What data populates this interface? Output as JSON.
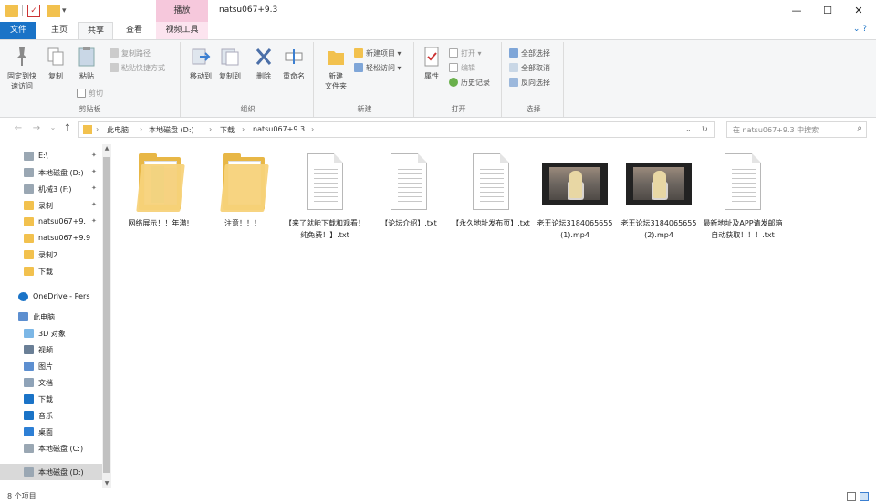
{
  "window": {
    "title": "natsu067+9.3",
    "context_tab_header": "播放",
    "controls": {
      "minimize": "—",
      "maximize": "☐",
      "close": "✕"
    }
  },
  "quick_access": {
    "dropdown": "▾"
  },
  "tabs": {
    "file": "文件",
    "home": "主页",
    "share": "共享",
    "view": "查看",
    "video_tools": "视频工具",
    "help": "⌄ ?"
  },
  "ribbon": {
    "clipboard": {
      "label": "剪贴板",
      "pin": "固定到快\n速访问",
      "copy": "复制",
      "paste": "粘贴",
      "copy_path": "复制路径",
      "paste_shortcut": "粘贴快捷方式",
      "cut": "剪切"
    },
    "organize": {
      "label": "组织",
      "move_to": "移动到",
      "copy_to": "复制到",
      "delete": "删除",
      "rename": "重命名"
    },
    "new": {
      "label": "新建",
      "new_folder": "新建\n文件夹",
      "new_item": "新建项目 ▾",
      "easy_access": "轻松访问 ▾"
    },
    "open": {
      "label": "打开",
      "properties": "属性",
      "open": "打开 ▾",
      "edit": "编辑",
      "history": "历史记录"
    },
    "select": {
      "label": "选择",
      "select_all": "全部选择",
      "select_none": "全部取消",
      "invert": "反向选择"
    }
  },
  "nav": {
    "back": "←",
    "forward": "→",
    "recent": "⌄",
    "up": "↑",
    "breadcrumbs": [
      "此电脑",
      "本地磁盘 (D:)",
      "下载",
      "natsu067+9.3"
    ],
    "crumb_sep": "›",
    "dropdown": "⌄",
    "refresh": "↻",
    "search_placeholder": "在 natsu067+9.3 中搜索",
    "search_icon": "⌕"
  },
  "sidebar": {
    "items": [
      {
        "label": "E:\\",
        "icon": "drive-icon",
        "pinned": true
      },
      {
        "label": "本地磁盘 (D:)",
        "icon": "drive-icon",
        "pinned": true
      },
      {
        "label": "机械3 (F:)",
        "icon": "drive-icon",
        "pinned": true
      },
      {
        "label": "录制",
        "icon": "folder-icon",
        "pinned": true
      },
      {
        "label": "natsu067+9.",
        "icon": "folder-icon",
        "pinned": true
      },
      {
        "label": "natsu067+9.9",
        "icon": "folder-icon",
        "pinned": false
      },
      {
        "label": "录制2",
        "icon": "folder-icon",
        "pinned": false
      },
      {
        "label": "下载",
        "icon": "folder-icon",
        "pinned": false
      },
      {
        "label": "OneDrive - Pers",
        "icon": "cloud-icon",
        "pinned": false
      },
      {
        "label": "此电脑",
        "icon": "computer-icon",
        "pinned": false
      },
      {
        "label": "3D 对象",
        "icon": "3d-objects-icon",
        "pinned": false
      },
      {
        "label": "视频",
        "icon": "video-icon",
        "pinned": false
      },
      {
        "label": "图片",
        "icon": "pictures-icon",
        "pinned": false
      },
      {
        "label": "文档",
        "icon": "documents-icon",
        "pinned": false
      },
      {
        "label": "下载",
        "icon": "download-icon",
        "pinned": false
      },
      {
        "label": "音乐",
        "icon": "music-icon",
        "pinned": false
      },
      {
        "label": "桌面",
        "icon": "desktop-icon",
        "pinned": false
      },
      {
        "label": "本地磁盘 (C:)",
        "icon": "drive-icon",
        "pinned": false
      },
      {
        "label": "本地磁盘 (D:)",
        "icon": "drive-icon",
        "pinned": false,
        "selected": true
      }
    ],
    "pin_glyph": "📌",
    "scroll_up": "▲",
    "scroll_down": "▼"
  },
  "files": [
    {
      "name": "网络展示！！年满!",
      "type": "folder"
    },
    {
      "name": "注意！！！",
      "type": "folder"
    },
    {
      "name": "【来了就能下载和观看！纯免费！】.txt",
      "type": "txt"
    },
    {
      "name": "【论坛介绍】.txt",
      "type": "txt"
    },
    {
      "name": "【永久地址发布页】.txt",
      "type": "txt"
    },
    {
      "name": "老王论坛3184065655(1).mp4",
      "type": "mp4"
    },
    {
      "name": "老王论坛3184065655(2).mp4",
      "type": "mp4"
    },
    {
      "name": "最新地址及APP请发邮箱自动获取！！！.txt",
      "type": "txt"
    }
  ],
  "status": {
    "count": "8 个项目"
  },
  "colors": {
    "accent": "#1a73c7",
    "context_tab": "#f6c8dc",
    "folder": "#e8b746",
    "selected": "#d9d9d9"
  }
}
